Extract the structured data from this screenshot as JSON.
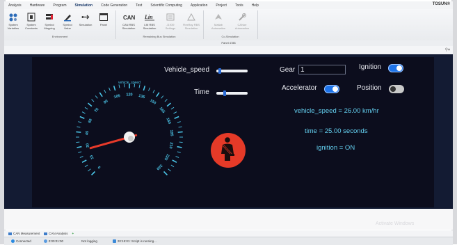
{
  "menu": {
    "items": [
      "Analysis",
      "Hardware",
      "Program",
      "Simulation",
      "Code Generation",
      "Test",
      "Scientific Computing",
      "Application",
      "Project",
      "Tools",
      "Help"
    ],
    "active_index": 3,
    "brand": "TOSUN®"
  },
  "ribbon": {
    "environment": {
      "caption": "Environment",
      "buttons": [
        {
          "label1": "System",
          "label2": "Variables",
          "icon": "variables-icon"
        },
        {
          "label1": "System",
          "label2": "Constants",
          "icon": "constants-icon"
        },
        {
          "label1": "Symbol",
          "label2": "Mapping",
          "icon": "mapping-icon"
        },
        {
          "label1": "Symbol",
          "label2": "Value",
          "icon": "value-icon"
        },
        {
          "label1": "Simulation",
          "label2": "",
          "icon": "simulation-icon"
        },
        {
          "label1": "Panel",
          "label2": "",
          "icon": "panel-icon"
        }
      ]
    },
    "remaining_bus": {
      "caption": "Remaining Bus Simulation",
      "buttons": [
        {
          "label1": "CAN RBS",
          "label2": "Simulation",
          "icon": "can-icon"
        },
        {
          "label1": "LIN RBS",
          "label2": "Simulation",
          "icon": "lin-icon"
        },
        {
          "label1": "J1939",
          "label2": "Settings",
          "icon": "j1939-icon"
        },
        {
          "label1": "FlexRay RBS",
          "label2": "Simulation",
          "icon": "flexray-icon"
        }
      ]
    },
    "co_simulation": {
      "caption": "Co-Simulation",
      "buttons": [
        {
          "label1": "Matlab",
          "label2": "Automation",
          "icon": "matlab-icon"
        },
        {
          "label1": "CANoe",
          "label2": "Automation",
          "icon": "canoe-icon"
        }
      ]
    },
    "panel_caption": "Panel 4788"
  },
  "dashboard": {
    "vehicle_speed_label": "Vehicle_speed",
    "time_label": "Time",
    "gear_label": "Gear",
    "gear_value": "1",
    "ignition_label": "Ignition",
    "accelerator_label": "Accelerator",
    "position_label": "Position",
    "vehicle_speed_readout": "vehicle_speed = 26.00 km/hr",
    "time_readout": "time = 25.00 seconds",
    "ignition_readout": "ignition = ON",
    "gauge_title": "vehicle_speed",
    "gauge_value": 26,
    "gauge_max": 240,
    "gauge_ticks": [
      "0",
      "15",
      "30",
      "45",
      "60",
      "75",
      "90",
      "105",
      "120",
      "135",
      "150",
      "165",
      "180",
      "195",
      "210",
      "225",
      "240"
    ],
    "slider_vehicle_speed_fraction": 0.08,
    "slider_time_fraction": 0.25,
    "toggles": {
      "ignition": "on",
      "accelerator": "on",
      "position": "off"
    },
    "colors": {
      "accent_blue": "#1e73e8",
      "gauge_cyan": "#4cc7ea",
      "needle": "#e83a2a",
      "warning_red": "#e53a28"
    }
  },
  "bottom": {
    "tabs": [
      "CAN Measurement",
      "CAN Analysis"
    ],
    "tab_add": "+",
    "status": [
      "Connected",
      "0:00:01:00",
      "Not logging",
      "20:15:01: Script is running..."
    ],
    "watermark": "Activate Windows"
  }
}
